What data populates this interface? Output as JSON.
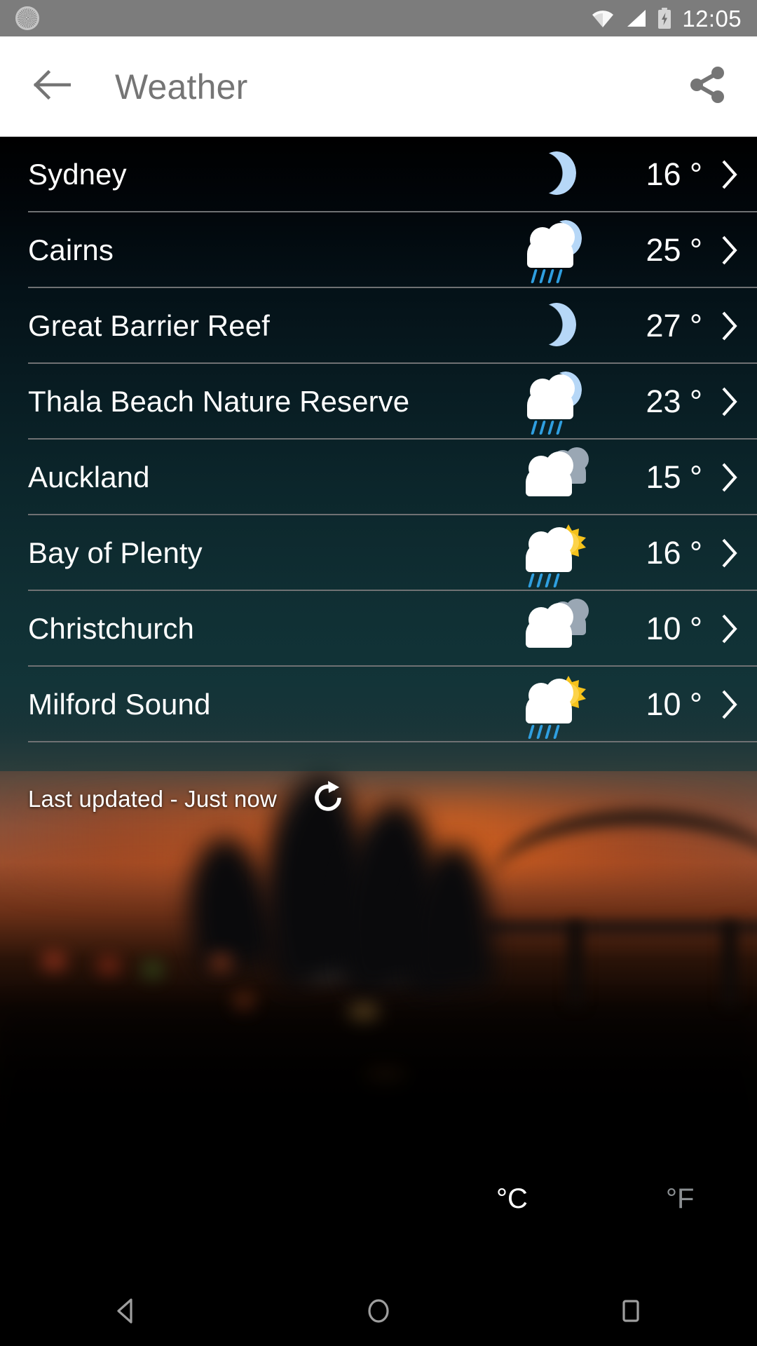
{
  "status_bar": {
    "time": "12:05",
    "icons": [
      "sync-spinner-icon",
      "wifi-icon",
      "cell-signal-icon",
      "battery-charging-icon"
    ]
  },
  "app_bar": {
    "back_icon": "arrow-left-icon",
    "title": "Weather",
    "share_icon": "share-icon"
  },
  "list": {
    "rows": [
      {
        "city": "Sydney",
        "temp": "16 °",
        "icon": "moon-icon",
        "chevron": "chevron-right-icon"
      },
      {
        "city": "Cairns",
        "temp": "25 °",
        "icon": "moon-cloud-rain-icon",
        "chevron": "chevron-right-icon"
      },
      {
        "city": "Great Barrier Reef",
        "temp": "27 °",
        "icon": "moon-icon",
        "chevron": "chevron-right-icon"
      },
      {
        "city": "Thala Beach Nature Reserve",
        "temp": "23 °",
        "icon": "moon-cloud-rain-icon",
        "chevron": "chevron-right-icon"
      },
      {
        "city": "Auckland",
        "temp": "15 °",
        "icon": "cloudy-icon",
        "chevron": "chevron-right-icon"
      },
      {
        "city": "Bay of Plenty",
        "temp": "16 °",
        "icon": "sun-cloud-rain-icon",
        "chevron": "chevron-right-icon"
      },
      {
        "city": "Christchurch",
        "temp": "10 °",
        "icon": "cloudy-icon",
        "chevron": "chevron-right-icon"
      },
      {
        "city": "Milford Sound",
        "temp": "10 °",
        "icon": "sun-cloud-rain-icon",
        "chevron": "chevron-right-icon"
      }
    ]
  },
  "footer": {
    "last_updated": "Last updated - Just now",
    "refresh_icon": "refresh-icon"
  },
  "units": {
    "celsius": "°C",
    "fahrenheit": "°F",
    "selected": "°C"
  },
  "nav_bar": {
    "back": "nav-back-icon",
    "home": "nav-home-icon",
    "recents": "nav-recents-icon"
  },
  "colors": {
    "status_bar_bg": "#7c7c7c",
    "app_bar_bg": "#ffffff",
    "app_bar_fg": "#757575",
    "list_text": "#ffffff",
    "divider": "#6f7173",
    "moon": "#b6d7f7",
    "sun": "#f5c21b",
    "rain": "#2f9fe0",
    "cloud_white": "#ffffff",
    "cloud_gray": "#9aa7b4",
    "unit_inactive": "#8b8f92"
  }
}
